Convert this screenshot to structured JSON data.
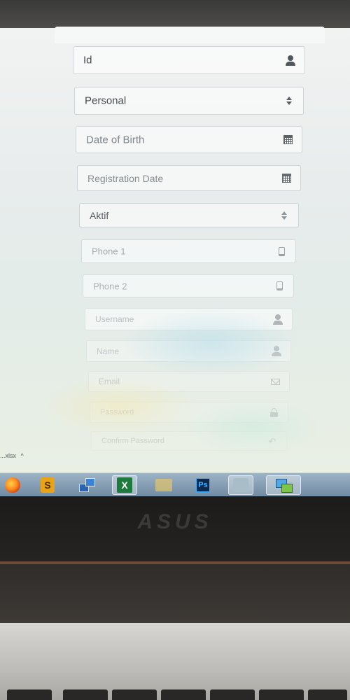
{
  "form": {
    "fields": [
      {
        "label": "Id",
        "icon": "user-icon",
        "is_value": true
      },
      {
        "label": "Personal",
        "icon": "sort-icon",
        "is_value": true
      },
      {
        "label": "Date of Birth",
        "icon": "calendar-icon",
        "is_value": false
      },
      {
        "label": "Registration Date",
        "icon": "calendar-icon",
        "is_value": false
      },
      {
        "label": "Aktif",
        "icon": "sort-icon",
        "is_value": true
      },
      {
        "label": "Phone 1",
        "icon": "phone-icon",
        "is_value": false
      },
      {
        "label": "Phone 2",
        "icon": "phone-icon",
        "is_value": false
      },
      {
        "label": "Username",
        "icon": "user-icon",
        "is_value": false
      },
      {
        "label": "Name",
        "icon": "user-icon",
        "is_value": false
      },
      {
        "label": "Email",
        "icon": "envelope-icon",
        "is_value": false
      },
      {
        "label": "Password",
        "icon": "lock-icon",
        "is_value": false
      },
      {
        "label": "Confirm Password",
        "icon": "undo-icon",
        "is_value": false
      }
    ]
  },
  "download_bar": {
    "file_name": "...xlsx",
    "chevron": "^"
  },
  "taskbar": {
    "items": [
      {
        "name": "firefox-icon"
      },
      {
        "name": "sublime-text-icon",
        "label": "S"
      },
      {
        "name": "network-icon"
      },
      {
        "name": "excel-icon",
        "label": "X"
      },
      {
        "name": "folder-icon"
      },
      {
        "name": "photoshop-icon",
        "label": "Ps"
      },
      {
        "name": "app-icon"
      },
      {
        "name": "remote-desktop-icon"
      }
    ]
  },
  "laptop": {
    "brand": "ASUS"
  },
  "colors": {
    "field_border": "#cdd3d6",
    "icon": "#5a6066",
    "taskbar": "#7f98ae"
  }
}
